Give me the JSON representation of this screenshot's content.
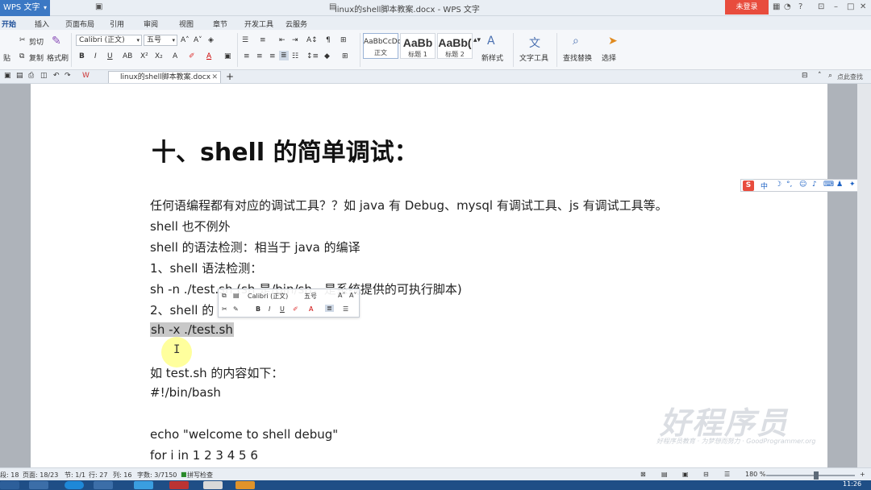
{
  "app": {
    "menu_label": "WPS 文字",
    "doc_title": "linux的shell脚本教案.docx - WPS 文字",
    "login_label": "未登录"
  },
  "menu_tabs": [
    "开始",
    "插入",
    "页面布局",
    "引用",
    "审阅",
    "视图",
    "章节",
    "开发工具",
    "云服务"
  ],
  "ribbon": {
    "cut_label": "剪切",
    "copy_label": "复制",
    "format_painter_label": "格式刷",
    "paste_label": "贴",
    "font_name": "Calibri (正文)",
    "font_size": "五号",
    "styles": [
      {
        "preview": "AaBbCcDd",
        "caption": "正文"
      },
      {
        "preview": "AaBb",
        "caption": "标题 1"
      },
      {
        "preview": "AaBb(",
        "caption": "标题 2"
      }
    ],
    "new_style_label": "新样式",
    "text_tools_label": "文字工具",
    "find_replace_label": "查找替换",
    "select_label": "选择"
  },
  "tabstrip": {
    "doc_tab_label": "linux的shell脚本教案.docx",
    "search_hint": "点此查找"
  },
  "document": {
    "heading": "十、shell 的简单调试：",
    "lines": [
      "任何语编程都有对应的调试工具？？如 java 有 Debug、mysql 有调试工具、js 有调试工具等。",
      "shell 也不例外",
      "shell 的语法检测：相当于 java 的编译",
      "1、shell 语法检测：",
      "sh -n ./test.sh      (sh 是/bin/sh，是系统提供的可执行脚本)",
      "2、shell 的",
      "sh -x ./test.sh",
      "",
      "如 test.sh 的内容如下：",
      "#!/bin/bash",
      "",
      "echo \"welcome to shell debug\"",
      "for i in 1 2 3 4 5 6"
    ],
    "mini_toolbar": {
      "font_name": "Calibri (正文)",
      "font_size": "五号"
    },
    "watermark": "好程序员",
    "watermark_sub": "好程序员教育 · 为梦想而努力 · GoodProgrammer.org"
  },
  "ime": {
    "logo": "S",
    "mode": "中"
  },
  "status": {
    "section": "段: 18",
    "page": "页面: 18/23",
    "node": "节: 1/1",
    "row": "行: 27",
    "col": "列: 16",
    "words": "字数: 3/7150",
    "spell": "拼写检查",
    "zoom": "180 %"
  },
  "taskbar": {
    "clock": "11:26"
  },
  "colors": {
    "accent": "#3b78c4",
    "login": "#e84c3d",
    "selection": "#c8c8c8"
  }
}
